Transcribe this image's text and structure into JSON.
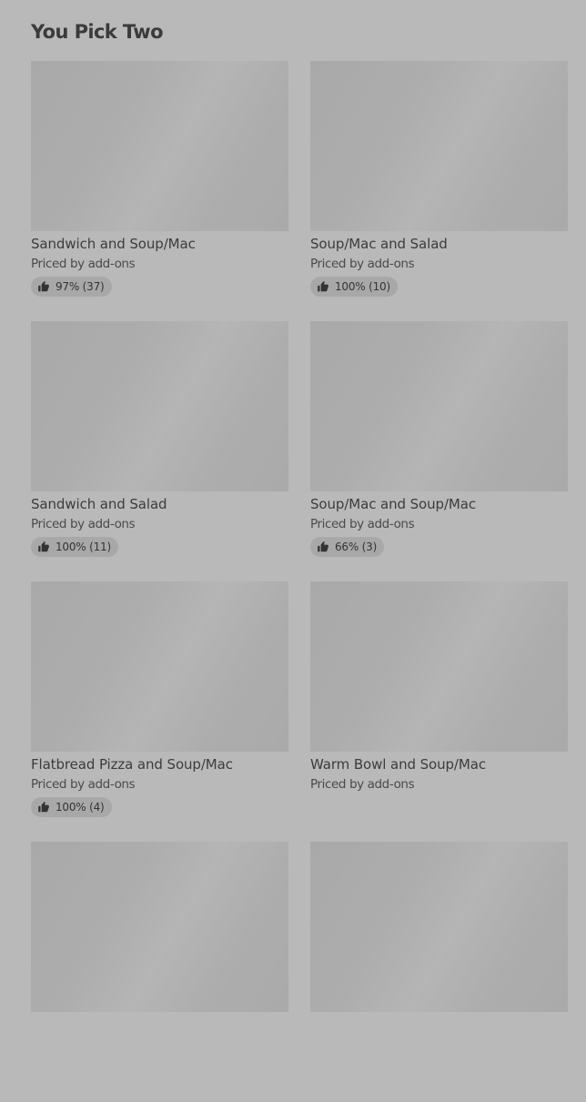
{
  "section": {
    "title": "You Pick Two"
  },
  "items": [
    {
      "title": "Sandwich and Soup/Mac",
      "price": "Priced by add-ons",
      "rating": "97% (37)"
    },
    {
      "title": "Soup/Mac and Salad",
      "price": "Priced by add-ons",
      "rating": "100% (10)"
    },
    {
      "title": "Sandwich and Salad",
      "price": "Priced by add-ons",
      "rating": "100% (11)"
    },
    {
      "title": "Soup/Mac and Soup/Mac",
      "price": "Priced by add-ons",
      "rating": "66% (3)"
    },
    {
      "title": "Flatbread Pizza and Soup/Mac",
      "price": "Priced by add-ons",
      "rating": "100% (4)"
    },
    {
      "title": "Warm Bowl and Soup/Mac",
      "price": "Priced by add-ons",
      "rating": null
    },
    {
      "title": null,
      "price": null,
      "rating": null
    },
    {
      "title": null,
      "price": null,
      "rating": null
    }
  ],
  "icons": {
    "rating": "thumbs-up-icon"
  },
  "colors": {
    "background": "#b9b9b9",
    "image_placeholder": "#adadad",
    "rating_pill": "#a8a8a8",
    "text": "#3a3a3a"
  }
}
